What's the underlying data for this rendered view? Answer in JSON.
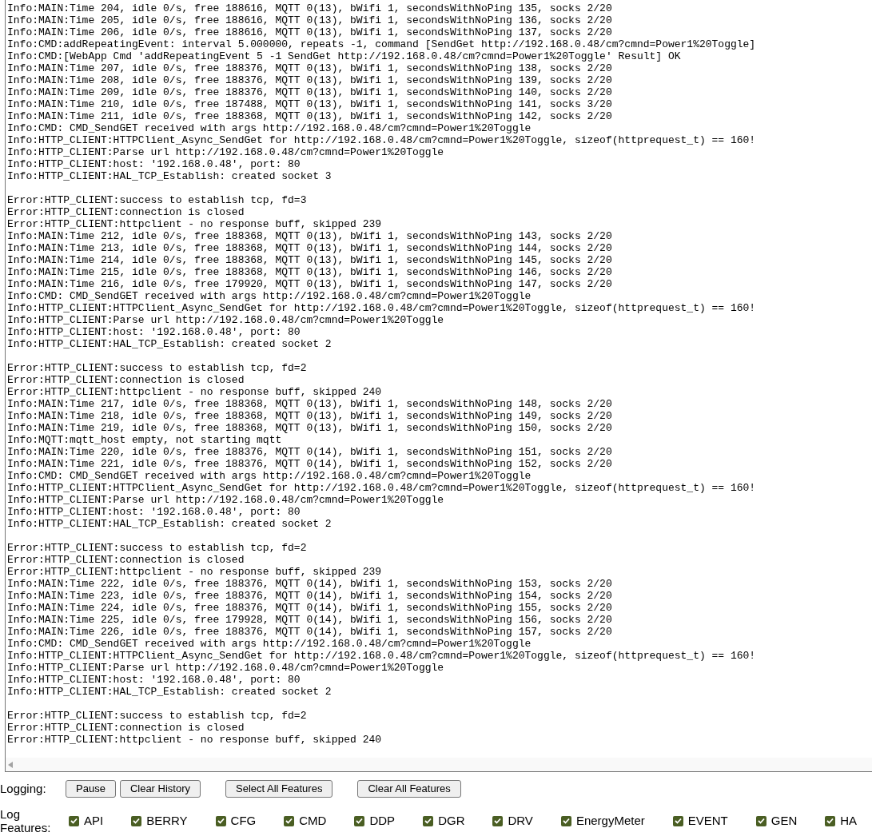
{
  "log_blocks": [
    [
      "Info:MAIN:Time 204, idle 0/s, free 188616, MQTT 0(13), bWifi 1, secondsWithNoPing 135, socks 2/20",
      "Info:MAIN:Time 205, idle 0/s, free 188616, MQTT 0(13), bWifi 1, secondsWithNoPing 136, socks 2/20",
      "Info:MAIN:Time 206, idle 0/s, free 188616, MQTT 0(13), bWifi 1, secondsWithNoPing 137, socks 2/20",
      "Info:CMD:addRepeatingEvent: interval 5.000000, repeats -1, command [SendGet http://192.168.0.48/cm?cmnd=Power1%20Toggle]",
      "Info:CMD:[WebApp Cmd 'addRepeatingEvent 5 -1 SendGet http://192.168.0.48/cm?cmnd=Power1%20Toggle' Result] OK",
      "Info:MAIN:Time 207, idle 0/s, free 188376, MQTT 0(13), bWifi 1, secondsWithNoPing 138, socks 2/20",
      "Info:MAIN:Time 208, idle 0/s, free 188376, MQTT 0(13), bWifi 1, secondsWithNoPing 139, socks 2/20",
      "Info:MAIN:Time 209, idle 0/s, free 188376, MQTT 0(13), bWifi 1, secondsWithNoPing 140, socks 2/20",
      "Info:MAIN:Time 210, idle 0/s, free 187488, MQTT 0(13), bWifi 1, secondsWithNoPing 141, socks 3/20",
      "Info:MAIN:Time 211, idle 0/s, free 188368, MQTT 0(13), bWifi 1, secondsWithNoPing 142, socks 2/20",
      "Info:CMD: CMD_SendGET received with args http://192.168.0.48/cm?cmnd=Power1%20Toggle",
      "Info:HTTP_CLIENT:HTTPClient_Async_SendGet for http://192.168.0.48/cm?cmnd=Power1%20Toggle, sizeof(httprequest_t) == 160!",
      "Info:HTTP_CLIENT:Parse url http://192.168.0.48/cm?cmnd=Power1%20Toggle",
      "Info:HTTP_CLIENT:host: '192.168.0.48', port: 80",
      "Info:HTTP_CLIENT:HAL_TCP_Establish: created socket 3"
    ],
    [
      "Error:HTTP_CLIENT:success to establish tcp, fd=3",
      "Error:HTTP_CLIENT:connection is closed",
      "Error:HTTP_CLIENT:httpclient - no response buff, skipped 239",
      "Info:MAIN:Time 212, idle 0/s, free 188368, MQTT 0(13), bWifi 1, secondsWithNoPing 143, socks 2/20",
      "Info:MAIN:Time 213, idle 0/s, free 188368, MQTT 0(13), bWifi 1, secondsWithNoPing 144, socks 2/20",
      "Info:MAIN:Time 214, idle 0/s, free 188368, MQTT 0(13), bWifi 1, secondsWithNoPing 145, socks 2/20",
      "Info:MAIN:Time 215, idle 0/s, free 188368, MQTT 0(13), bWifi 1, secondsWithNoPing 146, socks 2/20",
      "Info:MAIN:Time 216, idle 0/s, free 179920, MQTT 0(13), bWifi 1, secondsWithNoPing 147, socks 2/20",
      "Info:CMD: CMD_SendGET received with args http://192.168.0.48/cm?cmnd=Power1%20Toggle",
      "Info:HTTP_CLIENT:HTTPClient_Async_SendGet for http://192.168.0.48/cm?cmnd=Power1%20Toggle, sizeof(httprequest_t) == 160!",
      "Info:HTTP_CLIENT:Parse url http://192.168.0.48/cm?cmnd=Power1%20Toggle",
      "Info:HTTP_CLIENT:host: '192.168.0.48', port: 80",
      "Info:HTTP_CLIENT:HAL_TCP_Establish: created socket 2"
    ],
    [
      "Error:HTTP_CLIENT:success to establish tcp, fd=2",
      "Error:HTTP_CLIENT:connection is closed",
      "Error:HTTP_CLIENT:httpclient - no response buff, skipped 240",
      "Info:MAIN:Time 217, idle 0/s, free 188368, MQTT 0(13), bWifi 1, secondsWithNoPing 148, socks 2/20",
      "Info:MAIN:Time 218, idle 0/s, free 188368, MQTT 0(13), bWifi 1, secondsWithNoPing 149, socks 2/20",
      "Info:MAIN:Time 219, idle 0/s, free 188368, MQTT 0(13), bWifi 1, secondsWithNoPing 150, socks 2/20",
      "Info:MQTT:mqtt_host empty, not starting mqtt",
      "Info:MAIN:Time 220, idle 0/s, free 188376, MQTT 0(14), bWifi 1, secondsWithNoPing 151, socks 2/20",
      "Info:MAIN:Time 221, idle 0/s, free 188376, MQTT 0(14), bWifi 1, secondsWithNoPing 152, socks 2/20",
      "Info:CMD: CMD_SendGET received with args http://192.168.0.48/cm?cmnd=Power1%20Toggle",
      "Info:HTTP_CLIENT:HTTPClient_Async_SendGet for http://192.168.0.48/cm?cmnd=Power1%20Toggle, sizeof(httprequest_t) == 160!",
      "Info:HTTP_CLIENT:Parse url http://192.168.0.48/cm?cmnd=Power1%20Toggle",
      "Info:HTTP_CLIENT:host: '192.168.0.48', port: 80",
      "Info:HTTP_CLIENT:HAL_TCP_Establish: created socket 2"
    ],
    [
      "Error:HTTP_CLIENT:success to establish tcp, fd=2",
      "Error:HTTP_CLIENT:connection is closed",
      "Error:HTTP_CLIENT:httpclient - no response buff, skipped 239",
      "Info:MAIN:Time 222, idle 0/s, free 188376, MQTT 0(14), bWifi 1, secondsWithNoPing 153, socks 2/20",
      "Info:MAIN:Time 223, idle 0/s, free 188376, MQTT 0(14), bWifi 1, secondsWithNoPing 154, socks 2/20",
      "Info:MAIN:Time 224, idle 0/s, free 188376, MQTT 0(14), bWifi 1, secondsWithNoPing 155, socks 2/20",
      "Info:MAIN:Time 225, idle 0/s, free 179928, MQTT 0(14), bWifi 1, secondsWithNoPing 156, socks 2/20",
      "Info:MAIN:Time 226, idle 0/s, free 188376, MQTT 0(14), bWifi 1, secondsWithNoPing 157, socks 2/20",
      "Info:CMD: CMD_SendGET received with args http://192.168.0.48/cm?cmnd=Power1%20Toggle",
      "Info:HTTP_CLIENT:HTTPClient_Async_SendGet for http://192.168.0.48/cm?cmnd=Power1%20Toggle, sizeof(httprequest_t) == 160!",
      "Info:HTTP_CLIENT:Parse url http://192.168.0.48/cm?cmnd=Power1%20Toggle",
      "Info:HTTP_CLIENT:host: '192.168.0.48', port: 80",
      "Info:HTTP_CLIENT:HAL_TCP_Establish: created socket 2"
    ],
    [
      "Error:HTTP_CLIENT:success to establish tcp, fd=2",
      "Error:HTTP_CLIENT:connection is closed",
      "Error:HTTP_CLIENT:httpclient - no response buff, skipped 240"
    ]
  ],
  "logging": {
    "label": "Logging:",
    "buttons": [
      "Pause",
      "Clear History",
      "Select All Features",
      "Clear All Features"
    ]
  },
  "log_features": {
    "label": "Log Features:",
    "items": [
      {
        "label": "API",
        "checked": true
      },
      {
        "label": "BERRY",
        "checked": true
      },
      {
        "label": "CFG",
        "checked": true
      },
      {
        "label": "CMD",
        "checked": true
      },
      {
        "label": "DDP",
        "checked": true
      },
      {
        "label": "DGR",
        "checked": true
      },
      {
        "label": "DRV",
        "checked": true
      },
      {
        "label": "EnergyMeter",
        "checked": true
      },
      {
        "label": "EVENT",
        "checked": true
      },
      {
        "label": "GEN",
        "checked": true
      },
      {
        "label": "HA",
        "checked": true
      }
    ]
  }
}
